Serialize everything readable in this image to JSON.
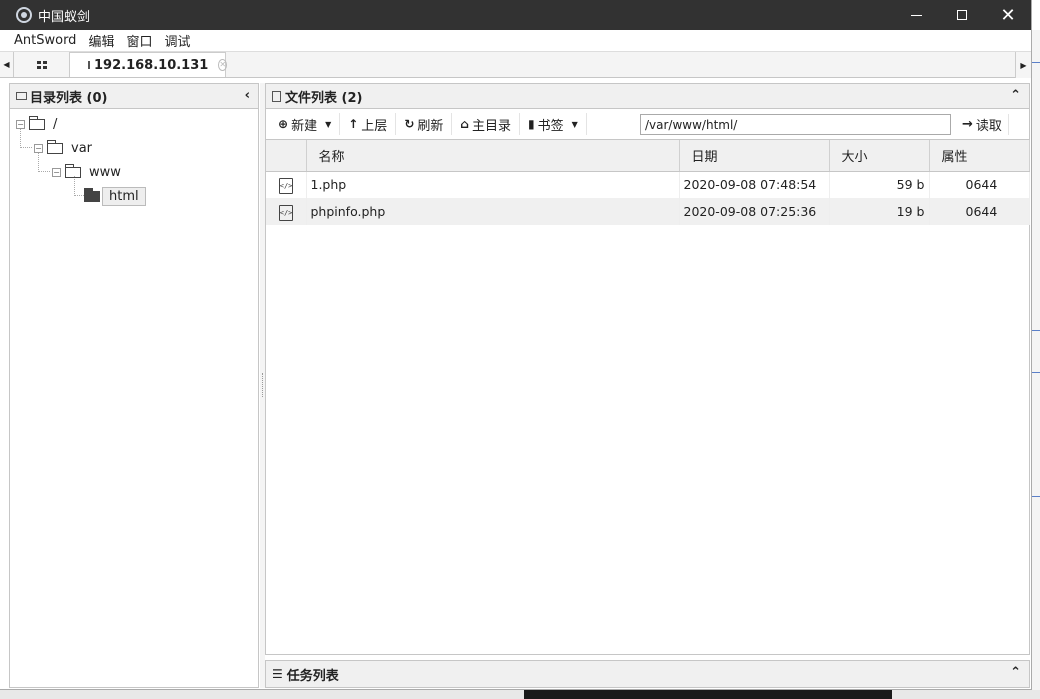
{
  "window": {
    "title": "中国蚁剑",
    "minimize_glyph": "—",
    "close_glyph": "✕"
  },
  "menu": {
    "items": [
      "AntSword",
      "编辑",
      "窗口",
      "调试"
    ]
  },
  "tabs": {
    "scroll_left": "◀",
    "scroll_right": "▶",
    "active_label": "192.168.10.131",
    "close_glyph": "✕"
  },
  "dir_panel": {
    "title": "目录列表 (0)",
    "collapse_glyph": "‹",
    "tree": {
      "root": "/",
      "var": "var",
      "www": "www",
      "html": "html",
      "toggle_glyph": "−"
    }
  },
  "file_panel": {
    "title": "文件列表 (2)",
    "collapse_glyph": "⌃",
    "toolbar": {
      "new_label": "新建",
      "up_label": "上层",
      "refresh_label": "刷新",
      "home_label": "主目录",
      "bookmark_label": "书签",
      "path_value": "/var/www/html/",
      "read_label": "读取"
    },
    "columns": [
      "名称",
      "日期",
      "大小",
      "属性"
    ],
    "files": [
      {
        "name": "1.php",
        "date": "2020-09-08 07:48:54",
        "size": "59 b",
        "perm": "0644"
      },
      {
        "name": "phpinfo.php",
        "date": "2020-09-08 07:25:36",
        "size": "19 b",
        "perm": "0644"
      }
    ],
    "file_icon_glyph": "</>"
  },
  "task_panel": {
    "title": "任务列表",
    "collapse_glyph": "⌃"
  }
}
